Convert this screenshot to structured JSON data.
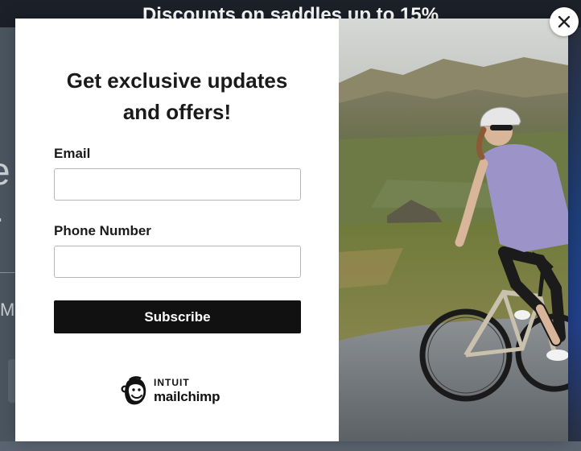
{
  "announcement": {
    "text": "Discounts on saddles up to 15%"
  },
  "background_fragments": {
    "line1": "e",
    "line2": "r",
    "line3": "M"
  },
  "popup": {
    "title": "Get exclusive updates and offers!",
    "email": {
      "label": "Email",
      "value": "",
      "placeholder": ""
    },
    "phone": {
      "label": "Phone Number",
      "value": "",
      "placeholder": ""
    },
    "subscribe_label": "Subscribe",
    "badge": {
      "brand_top": "INTUIT",
      "brand_name": "mailchimp",
      "icon": "mailchimp-freddie-icon"
    },
    "image": {
      "alt_subject": "cyclist-riding-road-bike-in-mountains"
    },
    "close_icon": "close-icon"
  },
  "colors": {
    "announcement_bg": "#1b2029",
    "button_bg": "#111111",
    "overlay": "#3f4851"
  }
}
